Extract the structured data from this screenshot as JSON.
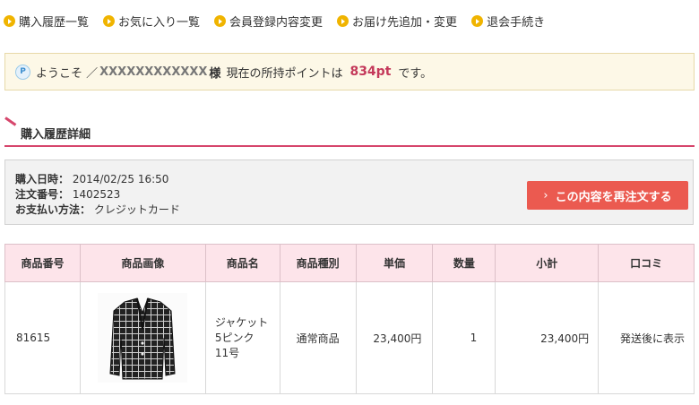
{
  "nav": [
    "購入履歴一覧",
    "お気に入り一覧",
    "会員登録内容変更",
    "お届け先追加・変更",
    "退会手続き"
  ],
  "welcome": {
    "icon": "P",
    "greeting": "ようこそ ／",
    "username": "XXXXXXXXXXXX",
    "honorific": "様",
    "points_prefix": "現在の所持ポイントは",
    "points": "834pt",
    "suffix": "です。"
  },
  "section_title": "購入履歴詳細",
  "order": {
    "date_label": "購入日時：",
    "date": "2014/02/25 16:50",
    "number_label": "注文番号：",
    "number": "1402523",
    "payment_label": "お支払い方法：",
    "payment": "クレジットカード",
    "reorder_button": "この内容を再注文する"
  },
  "table": {
    "headers": [
      "商品番号",
      "商品画像",
      "商品名",
      "商品種別",
      "単価",
      "数量",
      "小計",
      "口コミ"
    ],
    "rows": [
      {
        "code": "81615",
        "name_line1": "ジャケット",
        "name_line2": "5ピンク",
        "name_line3": "11号",
        "type": "通常商品",
        "price": "23,400円",
        "qty": "1",
        "subtotal": "23,400円",
        "review": "発送後に表示"
      }
    ]
  },
  "colors": {
    "accent": "#d6466c",
    "button": "#eb5a50",
    "nav_dot": "#f0b400",
    "header_bg": "#fde4ea"
  }
}
